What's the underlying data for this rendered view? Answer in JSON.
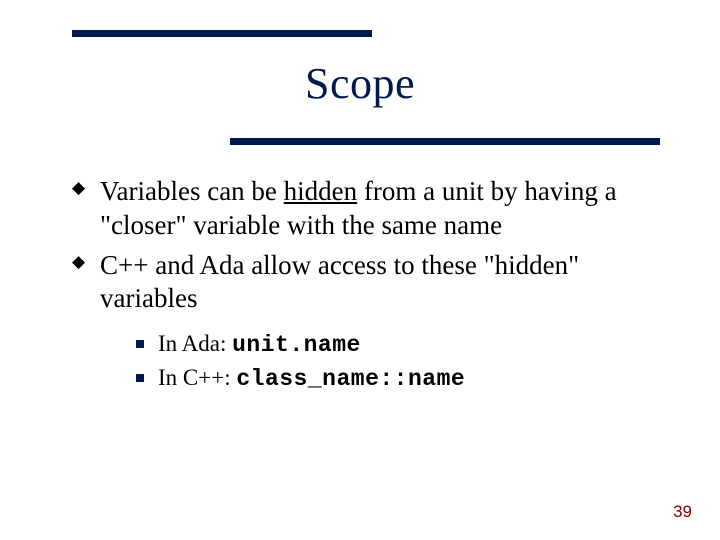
{
  "title": "Scope",
  "bullets": {
    "b1_pre": "Variables can be ",
    "b1_u": "hidden",
    "b1_post": " from a unit by having a \"closer\" variable with the same name",
    "b2": "C++ and Ada allow access to these \"hidden\" variables"
  },
  "sub": {
    "s1_label": "In Ada: ",
    "s1_code": "unit.name",
    "s2_label": "In C++: ",
    "s2_code": "class_name::name"
  },
  "page_number": "39"
}
